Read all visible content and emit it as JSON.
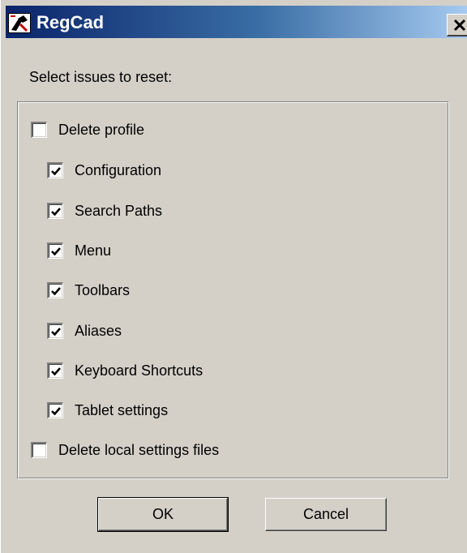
{
  "window": {
    "title": "RegCad",
    "close_glyph": "X"
  },
  "prompt": "Select issues to reset:",
  "options": [
    {
      "label": "Delete profile",
      "checked": false
    },
    {
      "label": "Configuration",
      "checked": true
    },
    {
      "label": "Search Paths",
      "checked": true
    },
    {
      "label": "Menu",
      "checked": true
    },
    {
      "label": "Toolbars",
      "checked": true
    },
    {
      "label": "Aliases",
      "checked": true
    },
    {
      "label": "Keyboard Shortcuts",
      "checked": true
    },
    {
      "label": "Tablet settings",
      "checked": true
    },
    {
      "label": "Delete local settings files",
      "checked": false
    }
  ],
  "buttons": {
    "ok_label": "OK",
    "cancel_label": "Cancel"
  },
  "colors": {
    "titlebar_start": "#0a246a",
    "titlebar_end": "#a6caf0",
    "face": "#d4d0c8"
  }
}
